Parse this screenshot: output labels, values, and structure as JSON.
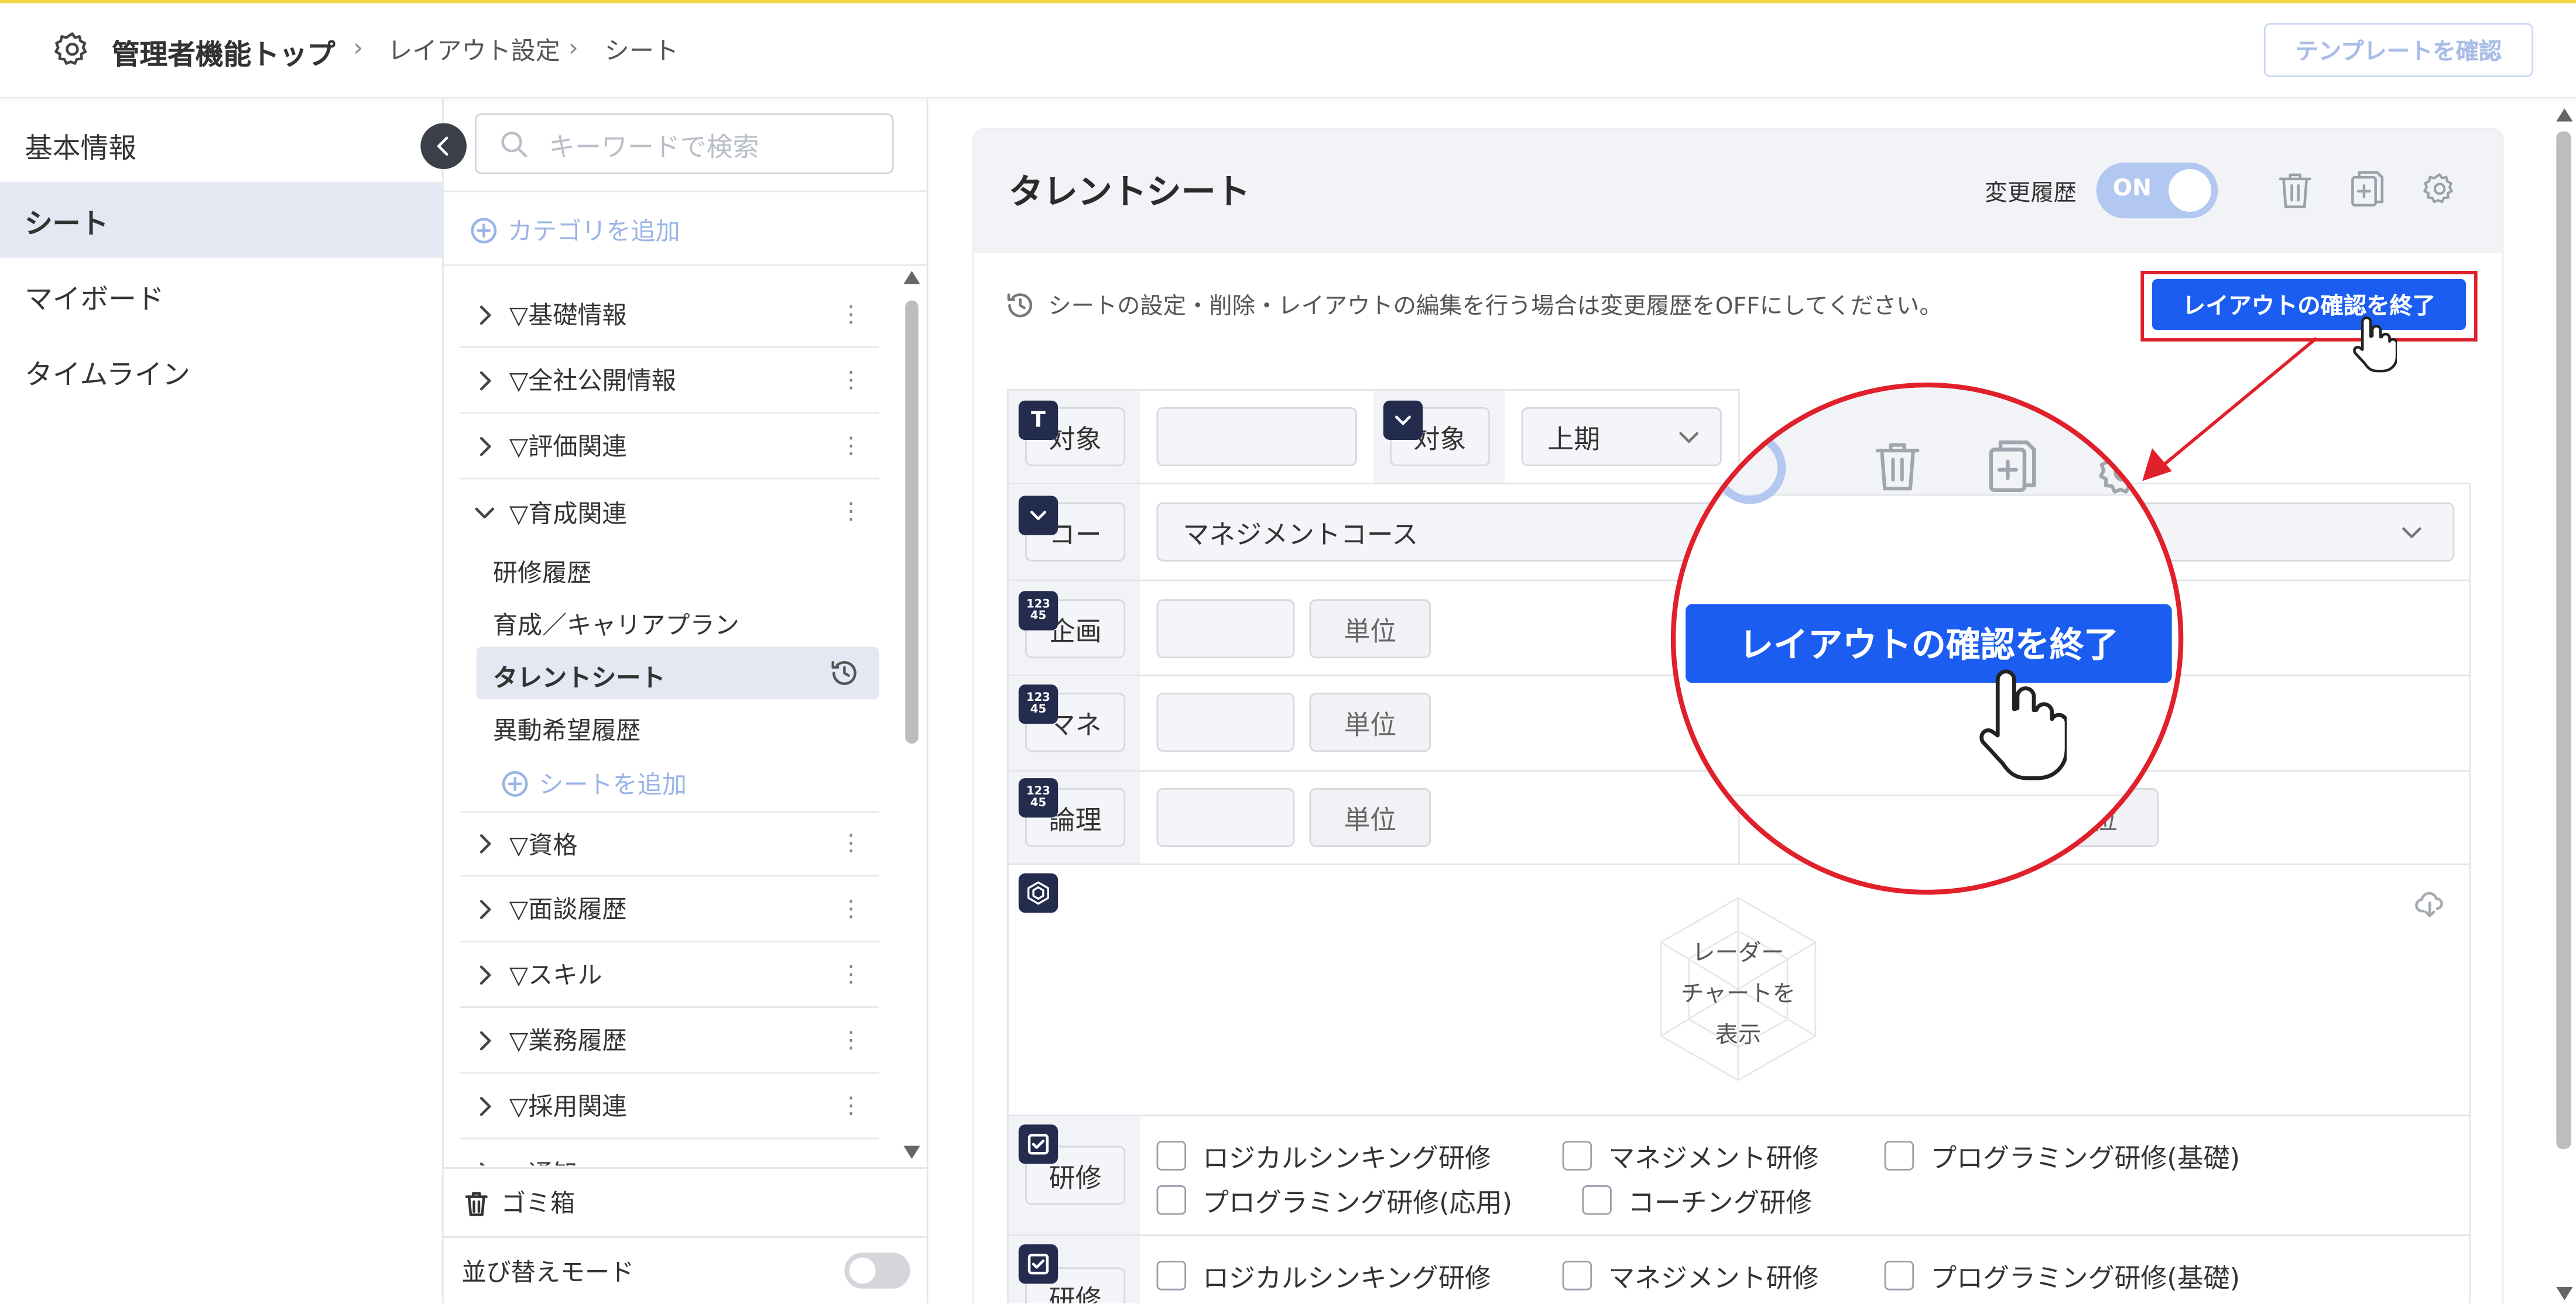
{
  "header": {
    "breadcrumb": [
      "管理者機能トップ",
      "レイアウト設定",
      "シート"
    ],
    "template_button": "テンプレートを確認"
  },
  "left_nav": {
    "items": [
      "基本情報",
      "シート",
      "マイボード",
      "タイムライン"
    ],
    "active": "シート"
  },
  "category_panel": {
    "search_placeholder": "キーワードで検索",
    "add_category": "カテゴリを追加",
    "categories": [
      "▽基礎情報",
      "▽全社公開情報",
      "▽評価関連",
      "▽育成関連",
      "▽資格",
      "▽面談履歴",
      "▽スキル",
      "▽業務履歴",
      "▽採用関連"
    ],
    "truncated_category": "▽通知",
    "expanded_sheets": [
      "研修履歴",
      "育成／キャリアプラン",
      "タレントシート",
      "異動希望履歴"
    ],
    "active_sheet": "タレントシート",
    "add_sheet": "シートを追加",
    "trash": "ゴミ箱",
    "sort_mode": "並び替えモード"
  },
  "sheet": {
    "title": "タレントシート",
    "history_label": "変更履歴",
    "history_toggle": "ON",
    "notice": "シートの設定・削除・レイアウトの編集を行う場合は変更履歴をOFFにしてください。",
    "end_layout_button": "レイアウトの確認を終了",
    "fields": {
      "target1_label": "対象",
      "target2_label": "対象",
      "period_value": "上期",
      "course_label": "コー",
      "course_value": "マネジメントコース",
      "num1_label": "企画",
      "num2_label": "マネ",
      "num3_label": "論理",
      "unit": "単位",
      "unit_partial": "位",
      "radar_text": [
        "レーダー",
        "チャートを",
        "表示"
      ],
      "training_label": "研修",
      "training_options": [
        "ロジカルシンキング研修",
        "マネジメント研修",
        "プログラミング研修(基礎)",
        "プログラミング研修(応用)",
        "コーチング研修"
      ]
    },
    "badges": {
      "text": "T",
      "number": "123 45"
    }
  },
  "zoom": {
    "button": "レイアウトの確認を終了"
  },
  "colors": {
    "primary": "#1a5df0",
    "highlight": "#e0202a",
    "badge": "#242c4e",
    "top_line": "#f3d94b"
  }
}
